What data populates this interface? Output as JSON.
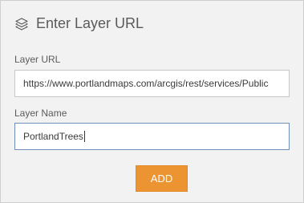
{
  "header": {
    "icon": "layers-icon",
    "title": "Enter Layer URL"
  },
  "url_field": {
    "label": "Layer URL",
    "value": "https://www.portlandmaps.com/arcgis/rest/services/Public"
  },
  "name_field": {
    "label": "Layer Name",
    "value": "PortlandTrees"
  },
  "add_button": {
    "label": "ADD"
  },
  "colors": {
    "panel_bg": "#f2f2f2",
    "accent": "#eb9431",
    "focus_border": "#6f8fb9"
  }
}
